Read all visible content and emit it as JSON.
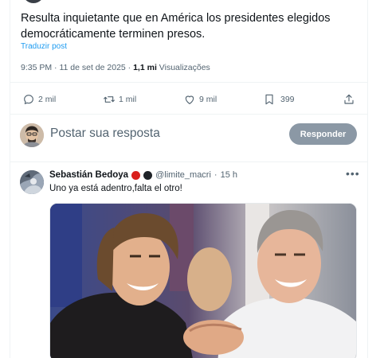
{
  "tweet": {
    "text": "Resulta inquietante que en América los presidentes elegidos democráticamente terminen presos.",
    "translate_label": "Traduzir post",
    "time": "9:35 PM",
    "date": "11 de set de 2025",
    "views_count": "1,1 mi",
    "views_label": "Visualizações"
  },
  "actions": {
    "replies": "2 mil",
    "reposts": "1 mil",
    "likes": "9 mil",
    "bookmarks": "399"
  },
  "composer": {
    "placeholder": "Postar sua resposta",
    "button_label": "Responder"
  },
  "reply": {
    "name": "Sebastián Bedoya",
    "handle": "@limite_macri",
    "separator": "·",
    "time": "15 h",
    "more": "•••",
    "text": "Uno ya está adentro,falta el otro!",
    "badge_colors": [
      "#d9201c",
      "#1f2328"
    ]
  },
  "colors": {
    "link": "#1d9bf0",
    "muted": "#536471",
    "button_disabled": "#8b98a5"
  }
}
